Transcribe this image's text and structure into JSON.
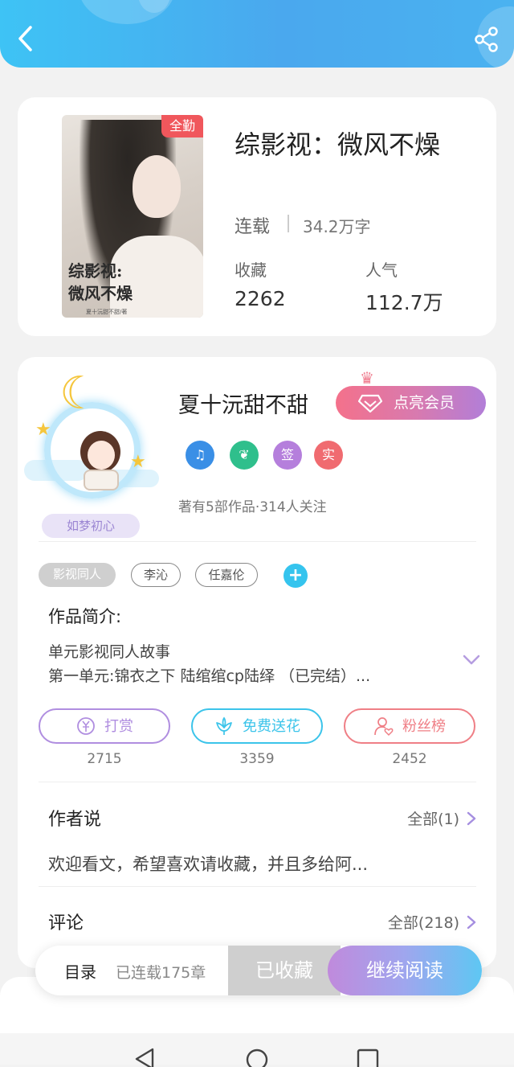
{
  "header": {
    "back_icon": "chevron-left-icon",
    "share_icon": "share-icon"
  },
  "book": {
    "cover_badge": "全勤",
    "cover_calligraphy_line1": "综影视:",
    "cover_calligraphy_line2": "微风不燥",
    "cover_small_text": "夏十沅甜不甜/著",
    "title": "综影视：微风不燥",
    "status": "连载",
    "word_count": "34.2万字",
    "favorites_label": "收藏",
    "favorites_value": "2262",
    "popularity_label": "人气",
    "popularity_value": "112.7万"
  },
  "author": {
    "avatar_tag": "如梦初心",
    "name": "夏十沅甜不甜",
    "vip_button": "点亮会员",
    "honors": [
      {
        "icon": "music-note-icon",
        "color": "#3a8fe6"
      },
      {
        "icon": "leaf-badge-icon",
        "color": "#2fbf8c"
      },
      {
        "label": "签",
        "color": "#b57fdc"
      },
      {
        "label": "实",
        "color": "#f06b70"
      }
    ],
    "works_info": "著有5部作品·314人关注"
  },
  "tags": [
    "影视同人",
    "李沁",
    "任嘉伦"
  ],
  "intro": {
    "heading": "作品简介:",
    "line1": "单元影视同人故事",
    "line2": "第一单元:锦衣之下 陆绾绾cp陆绎 （已完结）..."
  },
  "actions": [
    {
      "label": "打赏",
      "count": "2715",
      "color": "#b08ee0"
    },
    {
      "label": "免费送花",
      "count": "3359",
      "color": "#3cc4ea"
    },
    {
      "label": "粉丝榜",
      "count": "2452",
      "color": "#ef7f86"
    }
  ],
  "author_says": {
    "heading": "作者说",
    "more": "全部(1)",
    "text": "欢迎看文，希望喜欢请收藏，并且多给阿..."
  },
  "comments": {
    "heading": "评论",
    "more": "全部(218)"
  },
  "bottom_bar": {
    "toc": "目录",
    "chapters": "已连载175章",
    "collected": "已收藏",
    "continue": "继续阅读"
  }
}
